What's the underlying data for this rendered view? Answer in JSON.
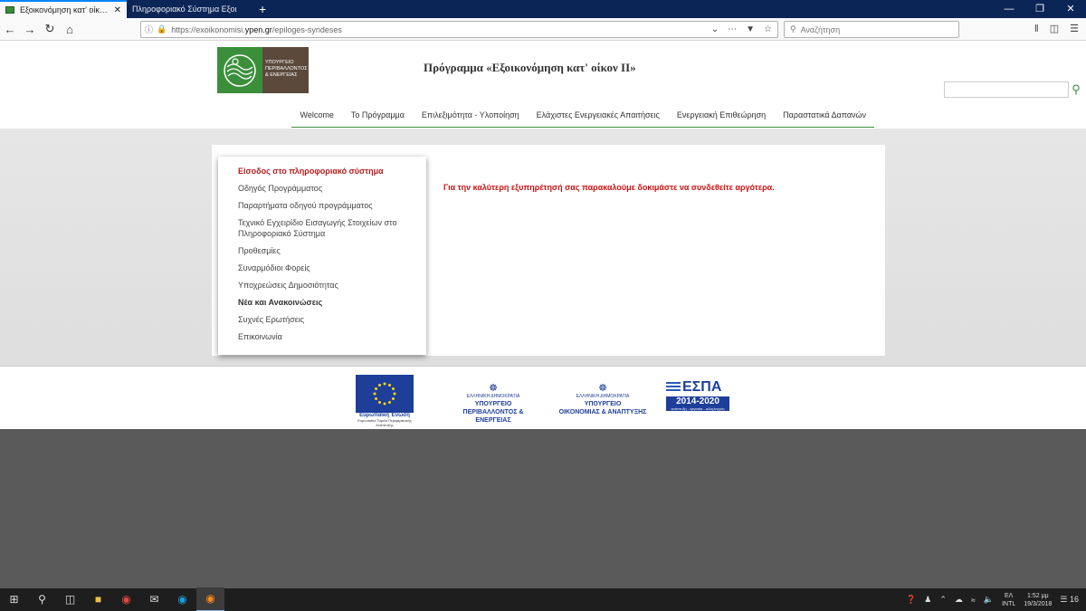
{
  "browser": {
    "tabs": [
      {
        "title": "Εξοικονόμηση κατ' οίκον ΙΙ» : Ε",
        "close": "✕"
      },
      {
        "title": "Πληροφοριακό Σύστημα Εξοι"
      }
    ],
    "newtab": "+",
    "url_prefix": "https://exoikonomisi.",
    "url_domain": "ypen.gr",
    "url_path": "/epiloges-syndeses",
    "search_placeholder": "Αναζήτηση"
  },
  "site": {
    "logo_text": "ΥΠΟΥΡΓΕΙΟ ΠΕΡΙΒΑΛΛΟΝΤΟΣ & ΕΝΕΡΓΕΙΑΣ",
    "title": "Πρόγραμμα «Εξοικονόμηση κατ' οίκον ΙΙ»",
    "nav": [
      "Welcome",
      "Το Πρόγραμμα",
      "Επιλεξιμότητα - Υλοποίηση",
      "Ελάχιστες Ενεργειακές Απαιτήσεις",
      "Ενεργειακή Επιθεώρηση",
      "Παραστατικά Δαπανών"
    ],
    "menu": [
      {
        "label": "Είσοδος στο πληροφοριακό σύστημα",
        "style": "active"
      },
      {
        "label": "Οδηγός Προγράμματος",
        "style": ""
      },
      {
        "label": "Παραρτήματα οδηγού προγράμματος",
        "style": ""
      },
      {
        "label": "Τεχνικό Εγχειρίδιο Εισαγωγής Στοιχείων στο Πληροφοριακό Σύστημα",
        "style": ""
      },
      {
        "label": "Προθεσμίες",
        "style": ""
      },
      {
        "label": "Συναρμόδιοι Φορείς",
        "style": ""
      },
      {
        "label": "Υποχρεώσεις Δημοσιότητας",
        "style": ""
      },
      {
        "label": "Νέα και Ανακοινώσεις",
        "style": "bold"
      },
      {
        "label": "Συχνές Ερωτήσεις",
        "style": ""
      },
      {
        "label": "Επικοινωνία",
        "style": ""
      }
    ],
    "notice": "Για την καλύτερη εξυπηρέτησή σας παρακαλούμε δοκιμάστε να συνδεθείτε αργότερα."
  },
  "footer": {
    "eu_label": "Ευρωπαϊκή Ένωση",
    "eu_sub": "Ευρωπαϊκό Ταμείο Περιφερειακής Ανάπτυξης",
    "m1_small": "ΕΛΛΗΝΙΚΗ ΔΗΜΟΚΡΑΤΙΑ",
    "m1_line1": "ΥΠΟΥΡΓΕΙΟ",
    "m1_line2": "ΠΕΡΙΒΑΛΛΟΝΤΟΣ & ΕΝΕΡΓΕΙΑΣ",
    "m2_small": "ΕΛΛΗΝΙΚΗ ΔΗΜΟΚΡΑΤΙΑ",
    "m2_line1": "ΥΠΟΥΡΓΕΙΟ",
    "m2_line2": "ΟΙΚΟΝΟΜΙΑΣ & ΑΝΑΠΤΥΞΗΣ",
    "espa_word": "ΕΣΠΑ",
    "espa_years": "2014-2020",
    "espa_sub": "ανάπτυξη - εργασία - αλληλεγγύη"
  },
  "taskbar": {
    "lang1": "ΕΛ",
    "lang2": "INTL",
    "time": "1:52 μμ",
    "date": "19/3/2018",
    "notif_count": "16"
  },
  "colors": {
    "accent_green": "#3b8f3b",
    "notice_red": "#cc1111",
    "tabbar": "#0c2557"
  }
}
